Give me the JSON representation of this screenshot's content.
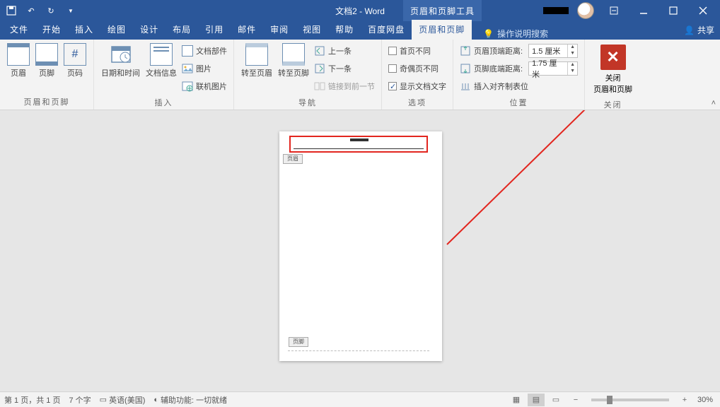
{
  "titlebar": {
    "doc_title": "文档2 - Word",
    "context_tool": "页眉和页脚工具"
  },
  "tabs": {
    "file": "文件",
    "home": "开始",
    "insert": "插入",
    "draw": "绘图",
    "design": "设计",
    "layout": "布局",
    "references": "引用",
    "mailings": "邮件",
    "review": "审阅",
    "view": "视图",
    "help": "帮助",
    "baidu": "百度网盘",
    "hf_design": "页眉和页脚",
    "tell_me": "操作说明搜索",
    "share": "共享"
  },
  "ribbon": {
    "g1": {
      "header": "页眉",
      "footer": "页脚",
      "pagenum": "页码",
      "label": "页眉和页脚"
    },
    "g2": {
      "datetime": "日期和时间",
      "docinfo": "文档信息",
      "docparts": "文档部件",
      "picture": "图片",
      "online_pic": "联机图片",
      "label": "插入"
    },
    "g3": {
      "goto_header": "转至页眉",
      "goto_footer": "转至页脚",
      "prev": "上一条",
      "next": "下一条",
      "link_prev": "链接到前一节",
      "label": "导航"
    },
    "g4": {
      "first_diff": "首页不同",
      "odd_even": "奇偶页不同",
      "show_doc": "显示文档文字",
      "label": "选项"
    },
    "g5": {
      "header_top": "页眉顶端距离:",
      "footer_bottom": "页脚底端距离:",
      "header_val": "1.5 厘米",
      "footer_val": "1.75 厘米",
      "align_tab": "插入对齐制表位",
      "label": "位置"
    },
    "g6": {
      "close": "关闭",
      "close_sub": "页眉和页脚",
      "label": "关闭"
    }
  },
  "page": {
    "header_tab": "页眉",
    "footer_tab": "页脚"
  },
  "status": {
    "page": "第 1 页，共 1 页",
    "words": "7 个字",
    "lang": "英语(美国)",
    "access": "辅助功能: 一切就绪",
    "zoom": "30%"
  }
}
